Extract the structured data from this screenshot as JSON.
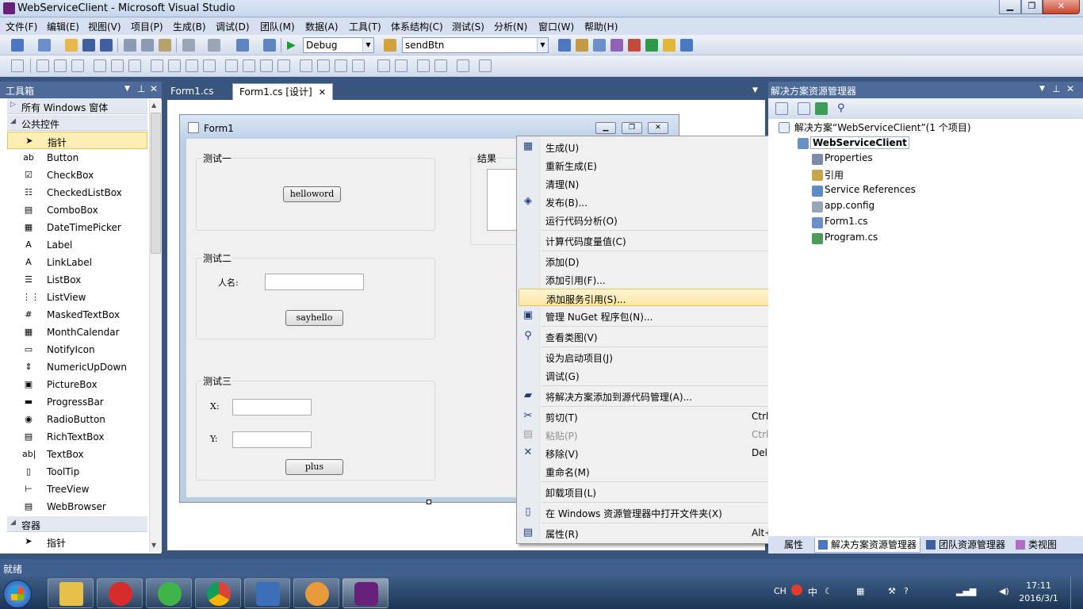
{
  "window": {
    "title": "WebServiceClient - Microsoft Visual Studio",
    "minimize": "▁",
    "restore": "❐",
    "close": "✕"
  },
  "menubar": [
    "文件(F)",
    "编辑(E)",
    "视图(V)",
    "项目(P)",
    "生成(B)",
    "调试(D)",
    "团队(M)",
    "数据(A)",
    "工具(T)",
    "体系结构(C)",
    "测试(S)",
    "分析(N)",
    "窗口(W)",
    "帮助(H)"
  ],
  "toolbar": {
    "config": "Debug",
    "target": "sendBtn"
  },
  "toolbox": {
    "title": "工具箱",
    "group_all": "所有 Windows 窗体",
    "group_common": "公共控件",
    "items": [
      {
        "label": "指针",
        "icon": "pointer-icon",
        "glyph": "➤"
      },
      {
        "label": "Button",
        "icon": "button-icon",
        "glyph": "ab"
      },
      {
        "label": "CheckBox",
        "icon": "checkbox-icon",
        "glyph": "☑"
      },
      {
        "label": "CheckedListBox",
        "icon": "checkedlistbox-icon",
        "glyph": "☷"
      },
      {
        "label": "ComboBox",
        "icon": "combobox-icon",
        "glyph": "▤"
      },
      {
        "label": "DateTimePicker",
        "icon": "datetimepicker-icon",
        "glyph": "▦"
      },
      {
        "label": "Label",
        "icon": "label-icon",
        "glyph": "A"
      },
      {
        "label": "LinkLabel",
        "icon": "linklabel-icon",
        "glyph": "A"
      },
      {
        "label": "ListBox",
        "icon": "listbox-icon",
        "glyph": "☰"
      },
      {
        "label": "ListView",
        "icon": "listview-icon",
        "glyph": "⋮⋮"
      },
      {
        "label": "MaskedTextBox",
        "icon": "maskedtextbox-icon",
        "glyph": "#"
      },
      {
        "label": "MonthCalendar",
        "icon": "monthcalendar-icon",
        "glyph": "▦"
      },
      {
        "label": "NotifyIcon",
        "icon": "notifyicon-icon",
        "glyph": "▭"
      },
      {
        "label": "NumericUpDown",
        "icon": "numericupdown-icon",
        "glyph": "⇕"
      },
      {
        "label": "PictureBox",
        "icon": "picturebox-icon",
        "glyph": "▣"
      },
      {
        "label": "ProgressBar",
        "icon": "progressbar-icon",
        "glyph": "▬"
      },
      {
        "label": "RadioButton",
        "icon": "radiobutton-icon",
        "glyph": "◉"
      },
      {
        "label": "RichTextBox",
        "icon": "richtextbox-icon",
        "glyph": "▤"
      },
      {
        "label": "TextBox",
        "icon": "textbox-icon",
        "glyph": "ab|"
      },
      {
        "label": "ToolTip",
        "icon": "tooltip-icon",
        "glyph": "▯"
      },
      {
        "label": "TreeView",
        "icon": "treeview-icon",
        "glyph": "⊢"
      },
      {
        "label": "WebBrowser",
        "icon": "webbrowser-icon",
        "glyph": "▤"
      }
    ],
    "group_container": "容器",
    "container_first": "指针"
  },
  "tabs": [
    {
      "label": "Form1.cs",
      "active": false
    },
    {
      "label": "Form1.cs [设计]",
      "active": true
    }
  ],
  "form": {
    "title": "Form1",
    "group1": {
      "title": "测试一",
      "button": "helloword"
    },
    "group2": {
      "title": "测试二",
      "label": "人名:",
      "button": "sayhello"
    },
    "group3": {
      "title": "测试三",
      "x_label": "X:",
      "y_label": "Y:",
      "button": "plus"
    },
    "result_title": "结果"
  },
  "context_menu": [
    {
      "label": "生成(U)",
      "icon": "build-icon",
      "glyph": "▦"
    },
    {
      "label": "重新生成(E)"
    },
    {
      "label": "清理(N)"
    },
    {
      "label": "发布(B)...",
      "icon": "publish-icon",
      "glyph": "◈"
    },
    {
      "label": "运行代码分析(O)"
    },
    {
      "sep": true
    },
    {
      "label": "计算代码度量值(C)"
    },
    {
      "sep": true
    },
    {
      "label": "添加(D)",
      "submenu": true
    },
    {
      "label": "添加引用(F)..."
    },
    {
      "label": "添加服务引用(S)...",
      "highlighted": true
    },
    {
      "label": "管理 NuGet 程序包(N)...",
      "icon": "nuget-icon",
      "glyph": "▣"
    },
    {
      "sep": true
    },
    {
      "label": "查看类图(V)",
      "icon": "class-diagram-icon",
      "glyph": "⚲"
    },
    {
      "sep": true
    },
    {
      "label": "设为启动项目(J)"
    },
    {
      "label": "调试(G)",
      "submenu": true
    },
    {
      "sep": true
    },
    {
      "label": "将解决方案添加到源代码管理(A)...",
      "icon": "source-control-icon",
      "glyph": "▰"
    },
    {
      "sep": true
    },
    {
      "label": "剪切(T)",
      "icon": "cut-icon",
      "glyph": "✂",
      "shortcut": "Ctrl+X"
    },
    {
      "label": "粘贴(P)",
      "icon": "paste-icon",
      "glyph": "▤",
      "shortcut": "Ctrl+V",
      "disabled": true
    },
    {
      "label": "移除(V)",
      "icon": "remove-icon",
      "glyph": "✕",
      "shortcut": "Del"
    },
    {
      "label": "重命名(M)"
    },
    {
      "sep": true
    },
    {
      "label": "卸载项目(L)"
    },
    {
      "sep": true
    },
    {
      "label": "在 Windows 资源管理器中打开文件夹(X)",
      "icon": "open-folder-icon",
      "glyph": "▯"
    },
    {
      "sep": true
    },
    {
      "label": "属性(R)",
      "icon": "properties-icon",
      "glyph": "▤",
      "shortcut": "Alt+Enter"
    }
  ],
  "solution_explorer": {
    "title": "解决方案资源管理器",
    "solution": "解决方案“WebServiceClient”(1 个项目)",
    "project": "WebServiceClient",
    "items": [
      "Properties",
      "引用",
      "Service References",
      "app.config",
      "Form1.cs",
      "Program.cs"
    ],
    "bottom_tabs": [
      "属性",
      "解决方案资源管理器",
      "团队资源管理器",
      "类视图"
    ]
  },
  "statusbar": "就绪",
  "taskbar": {
    "tray": {
      "lang": "CH",
      "ime": "中"
    },
    "time": "17:11",
    "date": "2016/3/1"
  },
  "colors": {
    "accent": "#4d6a98",
    "highlight": "#fbe7a3"
  }
}
